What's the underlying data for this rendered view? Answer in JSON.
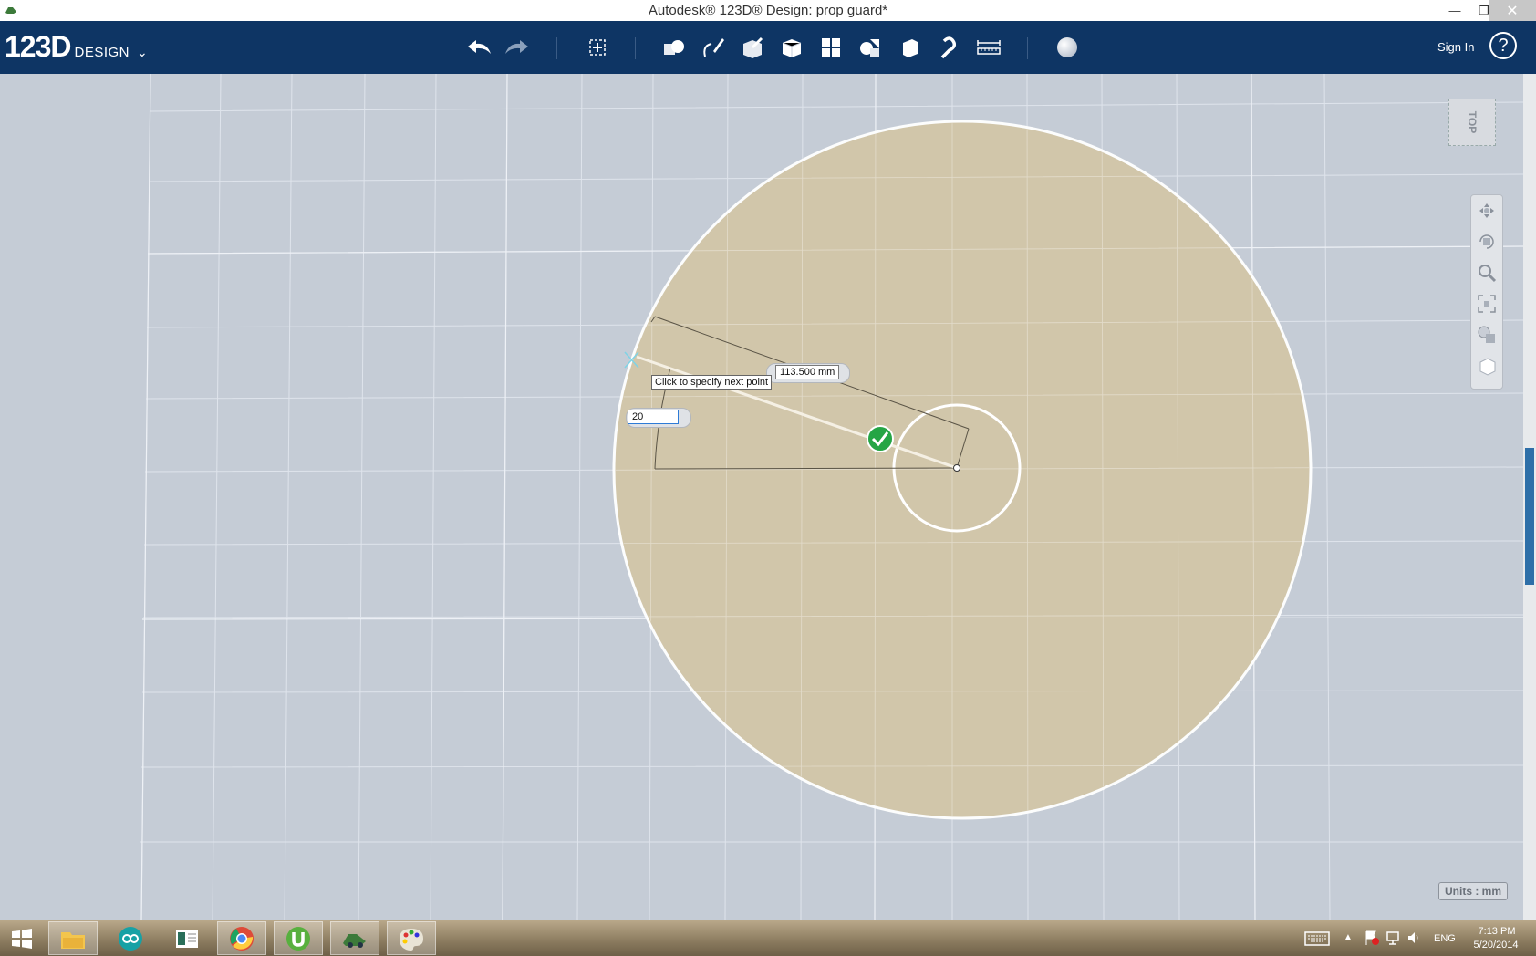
{
  "window": {
    "title": "Autodesk® 123D® Design: prop guard*"
  },
  "app": {
    "logo_main": "123D",
    "logo_sub": "DESIGN",
    "logo_menu_icon": "chevron-down-icon"
  },
  "toolbar": {
    "tools": [
      "undo-icon",
      "redo-icon",
      "transform-icon",
      "primitives-icon",
      "sketch-icon",
      "construct-icon",
      "modify-icon",
      "pattern-icon",
      "grouping-icon",
      "combine-icon",
      "snap-icon",
      "measure-icon",
      "material-icon"
    ],
    "sign_in": "Sign In",
    "help": "?"
  },
  "viewport": {
    "view_cube_label": "TOP",
    "dimension_length": "113.500 mm",
    "angle_input_value": "20",
    "tooltip": "Click to specify next point",
    "units": "Units : mm",
    "colors": {
      "fill": "#d2c6a9",
      "grid": "#e3e7ee",
      "background": "#c5ccd6"
    }
  },
  "nav_bar": [
    "pan-icon",
    "orbit-icon",
    "zoom-icon",
    "fit-icon",
    "view-mode-icon",
    "material-icon"
  ],
  "taskbar": {
    "apps": [
      "start-icon",
      "file-explorer-icon",
      "arduino-icon",
      "reader-icon",
      "chrome-icon",
      "utorrent-icon",
      "123d-design-icon",
      "paint-icon"
    ],
    "language": "ENG",
    "time": "7:13 PM",
    "date": "5/20/2014"
  }
}
